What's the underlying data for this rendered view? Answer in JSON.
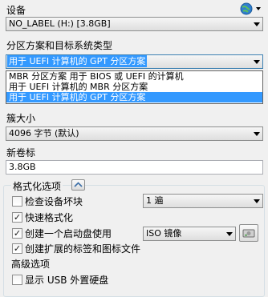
{
  "device": {
    "label": "设备",
    "selected": "NO_LABEL (H:) [3.8GB]"
  },
  "partition": {
    "label": "分区方案和目标系统类型",
    "selected": "用于 UEFI 计算机的 GPT 分区方案",
    "options": [
      "MBR 分区方案 用于 BIOS 或 UEFI 的计算机",
      "用于 UEFI 计算机的 MBR 分区方案",
      "用于 UEFI 计算机的 GPT 分区方案"
    ]
  },
  "cluster": {
    "label": "簇大小",
    "selected": "4096 字节 (默认)"
  },
  "volume": {
    "label": "新卷标",
    "value": "3.8GB"
  },
  "format_options": {
    "label": "格式化选项",
    "check_bad_blocks": {
      "label": "检查设备坏块",
      "checked": false
    },
    "passes": "1 遍",
    "quick_format": {
      "label": "快速格式化",
      "checked": true
    },
    "bootable": {
      "label": "创建一个启动盘使用",
      "checked": true,
      "type": "ISO 镜像"
    },
    "extended_label": {
      "label": "创建扩展的标签和图标文件",
      "checked": true
    }
  },
  "advanced": {
    "label": "高级选项",
    "show_usb_hdd": {
      "label": "显示 USB 外置硬盘",
      "checked": false
    }
  },
  "icons": {
    "globe": "globe-icon",
    "expand": "chevron-up-icon",
    "drive": "drive-icon"
  }
}
